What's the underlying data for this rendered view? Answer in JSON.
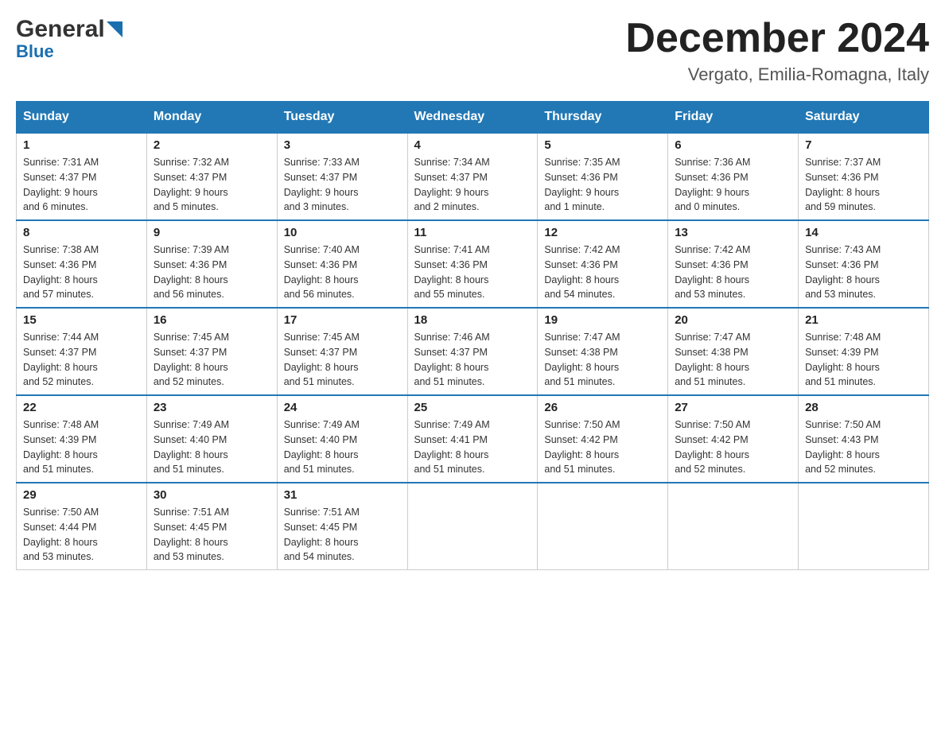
{
  "header": {
    "logo_general": "General",
    "logo_blue": "Blue",
    "month_title": "December 2024",
    "location": "Vergato, Emilia-Romagna, Italy"
  },
  "days_of_week": [
    "Sunday",
    "Monday",
    "Tuesday",
    "Wednesday",
    "Thursday",
    "Friday",
    "Saturday"
  ],
  "weeks": [
    [
      {
        "day": "1",
        "sunrise": "7:31 AM",
        "sunset": "4:37 PM",
        "daylight": "9 hours and 6 minutes."
      },
      {
        "day": "2",
        "sunrise": "7:32 AM",
        "sunset": "4:37 PM",
        "daylight": "9 hours and 5 minutes."
      },
      {
        "day": "3",
        "sunrise": "7:33 AM",
        "sunset": "4:37 PM",
        "daylight": "9 hours and 3 minutes."
      },
      {
        "day": "4",
        "sunrise": "7:34 AM",
        "sunset": "4:37 PM",
        "daylight": "9 hours and 2 minutes."
      },
      {
        "day": "5",
        "sunrise": "7:35 AM",
        "sunset": "4:36 PM",
        "daylight": "9 hours and 1 minute."
      },
      {
        "day": "6",
        "sunrise": "7:36 AM",
        "sunset": "4:36 PM",
        "daylight": "9 hours and 0 minutes."
      },
      {
        "day": "7",
        "sunrise": "7:37 AM",
        "sunset": "4:36 PM",
        "daylight": "8 hours and 59 minutes."
      }
    ],
    [
      {
        "day": "8",
        "sunrise": "7:38 AM",
        "sunset": "4:36 PM",
        "daylight": "8 hours and 57 minutes."
      },
      {
        "day": "9",
        "sunrise": "7:39 AM",
        "sunset": "4:36 PM",
        "daylight": "8 hours and 56 minutes."
      },
      {
        "day": "10",
        "sunrise": "7:40 AM",
        "sunset": "4:36 PM",
        "daylight": "8 hours and 56 minutes."
      },
      {
        "day": "11",
        "sunrise": "7:41 AM",
        "sunset": "4:36 PM",
        "daylight": "8 hours and 55 minutes."
      },
      {
        "day": "12",
        "sunrise": "7:42 AM",
        "sunset": "4:36 PM",
        "daylight": "8 hours and 54 minutes."
      },
      {
        "day": "13",
        "sunrise": "7:42 AM",
        "sunset": "4:36 PM",
        "daylight": "8 hours and 53 minutes."
      },
      {
        "day": "14",
        "sunrise": "7:43 AM",
        "sunset": "4:36 PM",
        "daylight": "8 hours and 53 minutes."
      }
    ],
    [
      {
        "day": "15",
        "sunrise": "7:44 AM",
        "sunset": "4:37 PM",
        "daylight": "8 hours and 52 minutes."
      },
      {
        "day": "16",
        "sunrise": "7:45 AM",
        "sunset": "4:37 PM",
        "daylight": "8 hours and 52 minutes."
      },
      {
        "day": "17",
        "sunrise": "7:45 AM",
        "sunset": "4:37 PM",
        "daylight": "8 hours and 51 minutes."
      },
      {
        "day": "18",
        "sunrise": "7:46 AM",
        "sunset": "4:37 PM",
        "daylight": "8 hours and 51 minutes."
      },
      {
        "day": "19",
        "sunrise": "7:47 AM",
        "sunset": "4:38 PM",
        "daylight": "8 hours and 51 minutes."
      },
      {
        "day": "20",
        "sunrise": "7:47 AM",
        "sunset": "4:38 PM",
        "daylight": "8 hours and 51 minutes."
      },
      {
        "day": "21",
        "sunrise": "7:48 AM",
        "sunset": "4:39 PM",
        "daylight": "8 hours and 51 minutes."
      }
    ],
    [
      {
        "day": "22",
        "sunrise": "7:48 AM",
        "sunset": "4:39 PM",
        "daylight": "8 hours and 51 minutes."
      },
      {
        "day": "23",
        "sunrise": "7:49 AM",
        "sunset": "4:40 PM",
        "daylight": "8 hours and 51 minutes."
      },
      {
        "day": "24",
        "sunrise": "7:49 AM",
        "sunset": "4:40 PM",
        "daylight": "8 hours and 51 minutes."
      },
      {
        "day": "25",
        "sunrise": "7:49 AM",
        "sunset": "4:41 PM",
        "daylight": "8 hours and 51 minutes."
      },
      {
        "day": "26",
        "sunrise": "7:50 AM",
        "sunset": "4:42 PM",
        "daylight": "8 hours and 51 minutes."
      },
      {
        "day": "27",
        "sunrise": "7:50 AM",
        "sunset": "4:42 PM",
        "daylight": "8 hours and 52 minutes."
      },
      {
        "day": "28",
        "sunrise": "7:50 AM",
        "sunset": "4:43 PM",
        "daylight": "8 hours and 52 minutes."
      }
    ],
    [
      {
        "day": "29",
        "sunrise": "7:50 AM",
        "sunset": "4:44 PM",
        "daylight": "8 hours and 53 minutes."
      },
      {
        "day": "30",
        "sunrise": "7:51 AM",
        "sunset": "4:45 PM",
        "daylight": "8 hours and 53 minutes."
      },
      {
        "day": "31",
        "sunrise": "7:51 AM",
        "sunset": "4:45 PM",
        "daylight": "8 hours and 54 minutes."
      },
      null,
      null,
      null,
      null
    ]
  ]
}
